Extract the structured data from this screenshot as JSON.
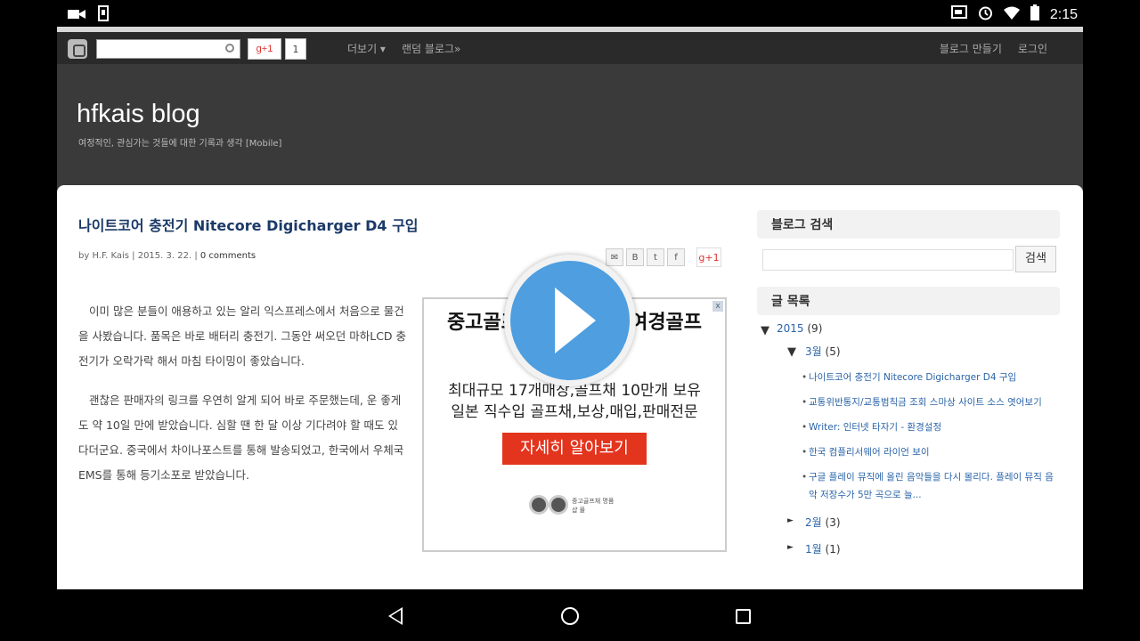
{
  "status_bar": {
    "time": "2:15",
    "icons_left": [
      "video-icon",
      "screen-icon"
    ],
    "icons_right": [
      "cast-icon",
      "alarm-icon",
      "wifi-icon",
      "battery-icon"
    ]
  },
  "topbar": {
    "gplus_label": "g+1",
    "gplus_count": "1",
    "nav": [
      "더보기 ▾",
      "랜덤 블로그»"
    ],
    "create_blog": "블로그 만들기",
    "login": "로그인"
  },
  "header": {
    "title": "hfkais blog",
    "description": "여정적인, 관심가는 것들에 대한 기록과 생각 [Mobile]"
  },
  "post": {
    "title": "나이트코어 충전기 Nitecore Digicharger D4 구입",
    "author": "by H.F. Kais",
    "date": "2015. 3. 22.",
    "comments": "0 comments",
    "share_plus": "g+1",
    "paragraphs": [
      "이미 많은 분들이 애용하고 있는 알리 익스프레스에서 처음으로 물건을 사봤습니다. 품목은 바로 배터리 충전기. 그동안 써오던 마하LCD 충전기가 오락가락 해서 마침 타이밍이 좋았습니다.",
      "괜찮은 판매자의 링크를 우연히 알게 되어 바로 주문했는데, 운 좋게도 약 10일 만에 받았습니다. 심할 땐 한 달 이상 기다려야 할 때도 있다더군요. 중국에서 차이나포스트를 통해 발송되었고, 한국에서 우체국 EMS를 통해 등기소포로 받았습니다."
    ]
  },
  "ad": {
    "title": "중고골프채 명품 모델 여경골프",
    "line1": "최대규모 17개매장,골프채 10만개 보유",
    "line2": "일본 직수입 골프채,보상,매입,판매전문",
    "button": "자세히 알아보기",
    "close": "x",
    "logo_text": "중고골프채\n명품샵 몰"
  },
  "sidebar": {
    "search_heading": "블로그 검색",
    "search_button": "검색",
    "archive_heading": "글 목록",
    "year": "2015",
    "year_count": "(9)",
    "month_open": "3월",
    "month_open_count": "(5)",
    "posts": [
      "나이트코어 충전기 Nitecore Digicharger D4 구입",
      "교통위반통지/교통범칙금 조회 스마상 사이트 소스 엿어보기",
      "Writer: 인터넷 타자기 - 환경설정",
      "한국 컴플리서웨어 라이언 보이",
      "구글 플레이 뮤직에 올린 음악들을 다시 몰리다. 플레이 뮤직 음악 저장수가 5만 곡으로 늘..."
    ],
    "months": [
      {
        "label": "2월",
        "count": "(3)"
      },
      {
        "label": "1월",
        "count": "(1)"
      }
    ]
  }
}
